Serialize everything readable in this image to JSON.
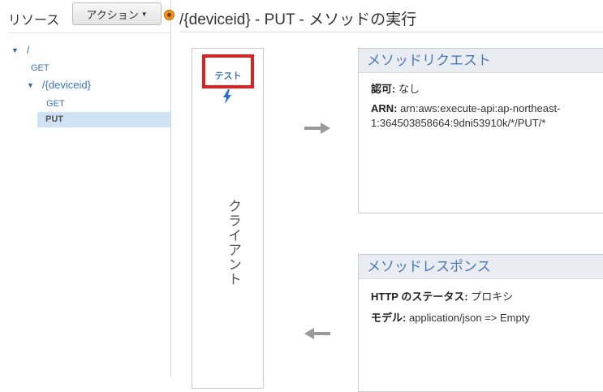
{
  "sidebar": {
    "title": "リソース",
    "action_button": "アクション",
    "tree": {
      "root": "/",
      "root_get": "GET",
      "child": "/{deviceid}",
      "child_get": "GET",
      "child_put": "PUT"
    }
  },
  "header": {
    "title": "/{deviceid} - PUT - メソッドの実行"
  },
  "client": {
    "test_label": "テスト",
    "label": "クライアント"
  },
  "method_request": {
    "title": "メソッドリクエスト",
    "auth_key": "認可:",
    "auth_value": "なし",
    "arn_key": "ARN:",
    "arn_value": "arn:aws:execute-api:ap-northeast-1:364503858664:9dni53910k/*/PUT/*"
  },
  "method_response": {
    "title": "メソッドレスポンス",
    "http_key": "HTTP のステータス:",
    "http_value": "プロキシ",
    "model_key": "モデル:",
    "model_value": "application/json => Empty"
  },
  "colors": {
    "accent": "#3a73b8",
    "highlight_border": "#e02020",
    "selected_bg": "#cfe2f3",
    "card_header_bg": "#e9edf2"
  },
  "icons": [
    "chevron-down-icon",
    "lightning-icon",
    "arrow-right-icon",
    "arrow-left-icon",
    "status-dot-icon"
  ]
}
